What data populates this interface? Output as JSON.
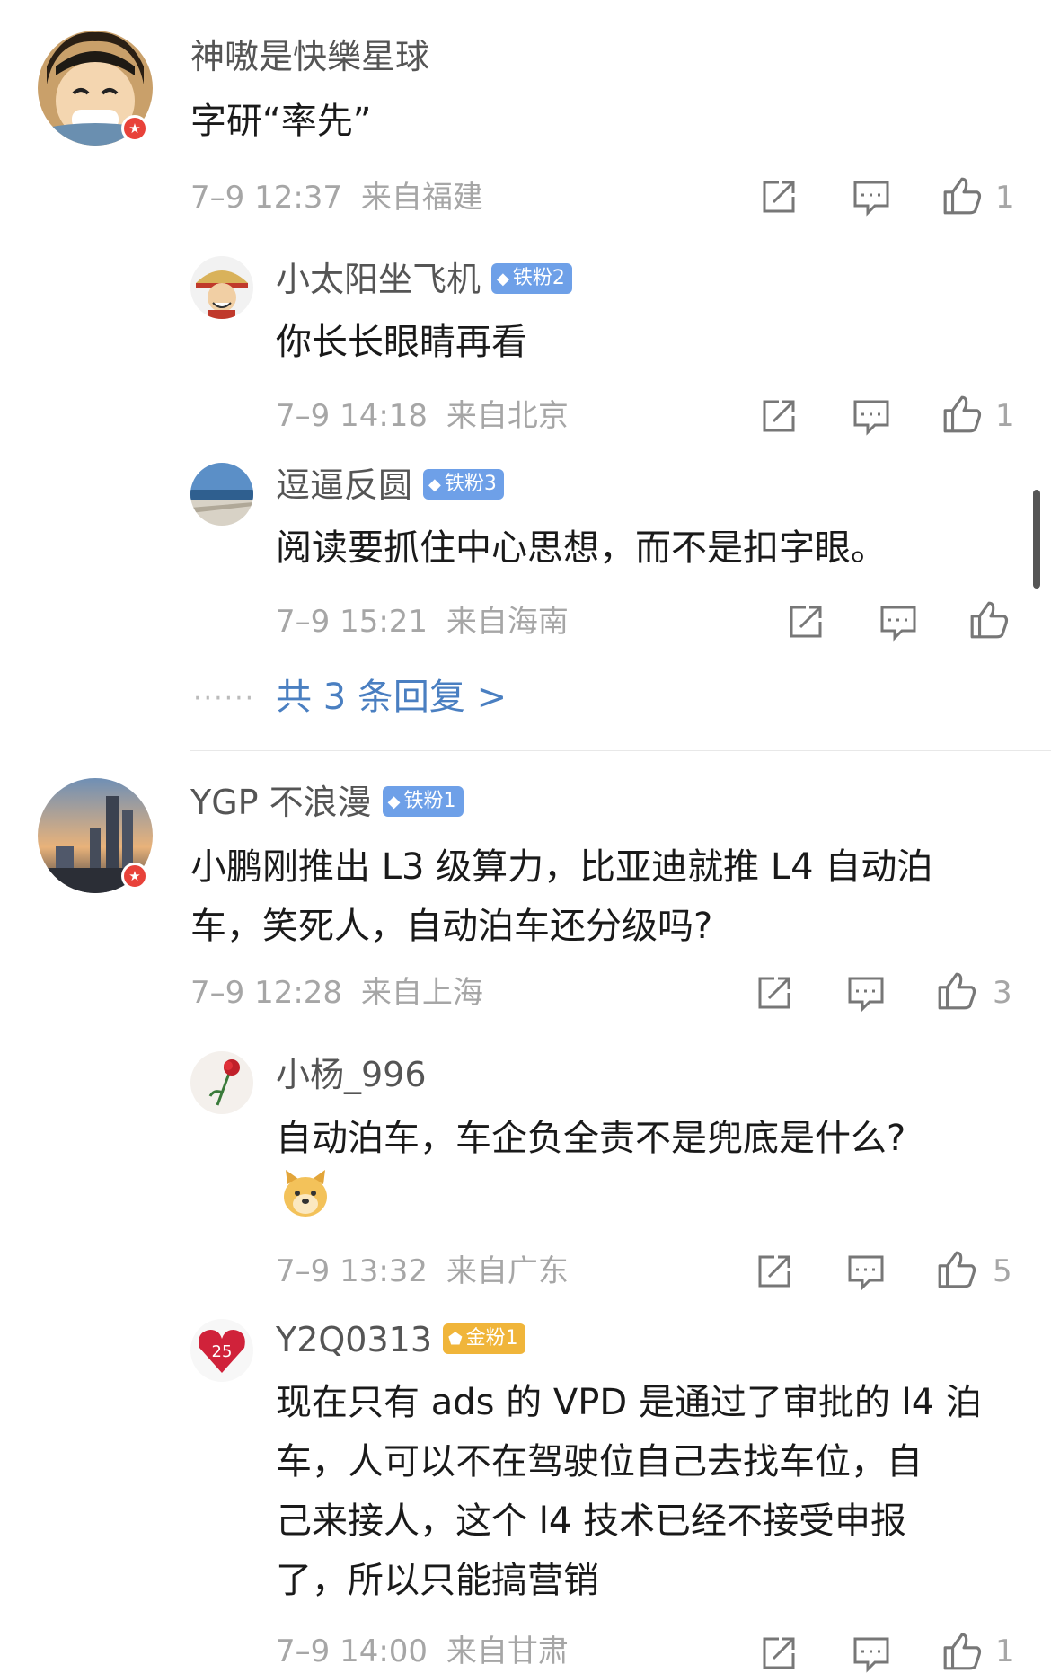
{
  "comments": [
    {
      "user": "神嗷是快樂星球",
      "text": [
        "字研“率先”"
      ],
      "time": "7–9 12:37",
      "location": "来自福建",
      "likes": "1",
      "replies": [
        {
          "user": "小太阳坐飞机",
          "badge": "铁粉2",
          "text": [
            "你长长眼睛再看"
          ],
          "time": "7–9 14:18",
          "location": "来自北京",
          "likes": "1"
        },
        {
          "user": "逗逼反圆",
          "badge": "铁粉3",
          "text": [
            "阅读要抓住中心思想，而不是扣字眼。"
          ],
          "time": "7–9 15:21",
          "location": "来自海南",
          "likes": ""
        }
      ],
      "more_label": "共 3 条回复 >"
    },
    {
      "user": "YGP 不浪漫",
      "badge": "铁粉1",
      "text": [
        "小鹏刚推出 L3 级算力，比亚迪就推 L4 自动泊",
        "车，笑死人，自动泊车还分级吗?"
      ],
      "time": "7–9 12:28",
      "location": "来自上海",
      "likes": "3",
      "replies": [
        {
          "user": "小杨_996",
          "text": [
            "自动泊车，车企负全责不是兜底是什么?"
          ],
          "emoji": "doge-emoji",
          "time": "7–9 13:32",
          "location": "来自广东",
          "likes": "5"
        },
        {
          "user": "Y2Q0313",
          "badge": "金粉1",
          "text": [
            "现在只有 ads 的 VPD 是通过了审批的 l4 泊",
            "车，人可以不在驾驶位自己去找车位，自",
            "己来接人，这个 l4 技术已经不接受申报",
            "了，所以只能搞营销"
          ],
          "time": "7–9 14:00",
          "location": "来自甘肃",
          "likes": "1"
        }
      ]
    }
  ],
  "icons": {
    "share": "share-icon",
    "comment": "comment-icon",
    "like": "thumbs-up-icon",
    "verified": "verified-star-icon"
  },
  "colors": {
    "link": "#4a7fc1",
    "fan_badge": "#6ea0e8",
    "gold_badge": "#f0b53a",
    "verified": "#e8423a"
  }
}
